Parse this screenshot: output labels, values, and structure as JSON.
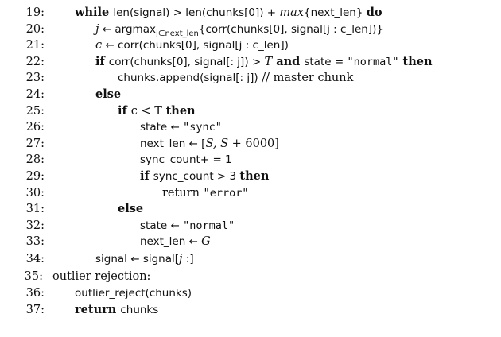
{
  "lines": [
    {
      "num": "19:",
      "indent": 1,
      "segments": [
        {
          "cls": "kw",
          "text": "while "
        },
        {
          "cls": "sf",
          "text": "len(signal) > len(chunks[0]) + "
        },
        {
          "cls": "it",
          "text": "max"
        },
        {
          "cls": "sf",
          "text": "{next_len} "
        },
        {
          "cls": "kw",
          "text": "do"
        }
      ]
    },
    {
      "num": "20:",
      "indent": 2,
      "segments": [
        {
          "cls": "it",
          "text": "j"
        },
        {
          "cls": "sf",
          "text": " ← argmax"
        },
        {
          "cls": "sf sub",
          "text": "j∈next_len"
        },
        {
          "cls": "sf",
          "text": "{corr(chunks[0], signal[j : c_len])}"
        }
      ]
    },
    {
      "num": "21:",
      "indent": 2,
      "segments": [
        {
          "cls": "it",
          "text": "c"
        },
        {
          "cls": "sf",
          "text": " ← corr(chunks[0], signal[j : c_len])"
        }
      ]
    },
    {
      "num": "22:",
      "indent": 2,
      "segments": [
        {
          "cls": "kw",
          "text": "if "
        },
        {
          "cls": "sf",
          "text": "corr(chunks[0], signal[: j]) > "
        },
        {
          "cls": "it",
          "text": "T"
        },
        {
          "cls": "kw",
          "text": " and "
        },
        {
          "cls": "sf",
          "text": "state = "
        },
        {
          "cls": "tt",
          "text": "\"normal\""
        },
        {
          "cls": "kw",
          "text": " then"
        }
      ]
    },
    {
      "num": "23:",
      "indent": 3,
      "segments": [
        {
          "cls": "sf",
          "text": "chunks.append(signal[: j])"
        },
        {
          "cls": "",
          "text": " // master chunk"
        }
      ]
    },
    {
      "num": "24:",
      "indent": 2,
      "segments": [
        {
          "cls": "kw",
          "text": "else"
        }
      ]
    },
    {
      "num": "25:",
      "indent": 3,
      "segments": [
        {
          "cls": "kw",
          "text": "if "
        },
        {
          "cls": "",
          "text": "c < T "
        },
        {
          "cls": "kw",
          "text": "then"
        }
      ]
    },
    {
      "num": "26:",
      "indent": 4,
      "segments": [
        {
          "cls": "sf",
          "text": "state ← "
        },
        {
          "cls": "tt",
          "text": "\"sync\""
        }
      ]
    },
    {
      "num": "27:",
      "indent": 4,
      "segments": [
        {
          "cls": "sf",
          "text": "next_len ← ["
        },
        {
          "cls": "it",
          "text": "S, S"
        },
        {
          "cls": "",
          "text": " + 6000]"
        }
      ]
    },
    {
      "num": "28:",
      "indent": 4,
      "segments": [
        {
          "cls": "sf",
          "text": "sync_count+ = 1"
        }
      ]
    },
    {
      "num": "29:",
      "indent": 4,
      "segments": [
        {
          "cls": "kw",
          "text": "if "
        },
        {
          "cls": "sf",
          "text": "sync_count > 3 "
        },
        {
          "cls": "kw",
          "text": "then"
        }
      ]
    },
    {
      "num": "30:",
      "indent": 5,
      "segments": [
        {
          "cls": "",
          "text": "return "
        },
        {
          "cls": "tt",
          "text": "\"error\""
        }
      ]
    },
    {
      "num": "31:",
      "indent": 3,
      "segments": [
        {
          "cls": "kw",
          "text": "else"
        }
      ]
    },
    {
      "num": "32:",
      "indent": 4,
      "segments": [
        {
          "cls": "sf",
          "text": "state ← "
        },
        {
          "cls": "tt",
          "text": "\"normal\""
        }
      ]
    },
    {
      "num": "33:",
      "indent": 4,
      "segments": [
        {
          "cls": "sf",
          "text": "next_len ← "
        },
        {
          "cls": "it",
          "text": "G"
        }
      ]
    },
    {
      "num": "34:",
      "indent": 2,
      "segments": [
        {
          "cls": "sf",
          "text": "signal ← signal["
        },
        {
          "cls": "it",
          "text": "j"
        },
        {
          "cls": "sf",
          "text": " :]"
        }
      ]
    },
    {
      "num": "35:",
      "indent": 0,
      "segments": [
        {
          "cls": "",
          "text": "outlier rejection:"
        }
      ]
    },
    {
      "num": "36:",
      "indent": 1,
      "segments": [
        {
          "cls": "sf",
          "text": "outlier_reject(chunks)"
        }
      ]
    },
    {
      "num": "37:",
      "indent": 1,
      "segments": [
        {
          "cls": "kw",
          "text": "return "
        },
        {
          "cls": "sf",
          "text": "chunks"
        }
      ]
    }
  ]
}
